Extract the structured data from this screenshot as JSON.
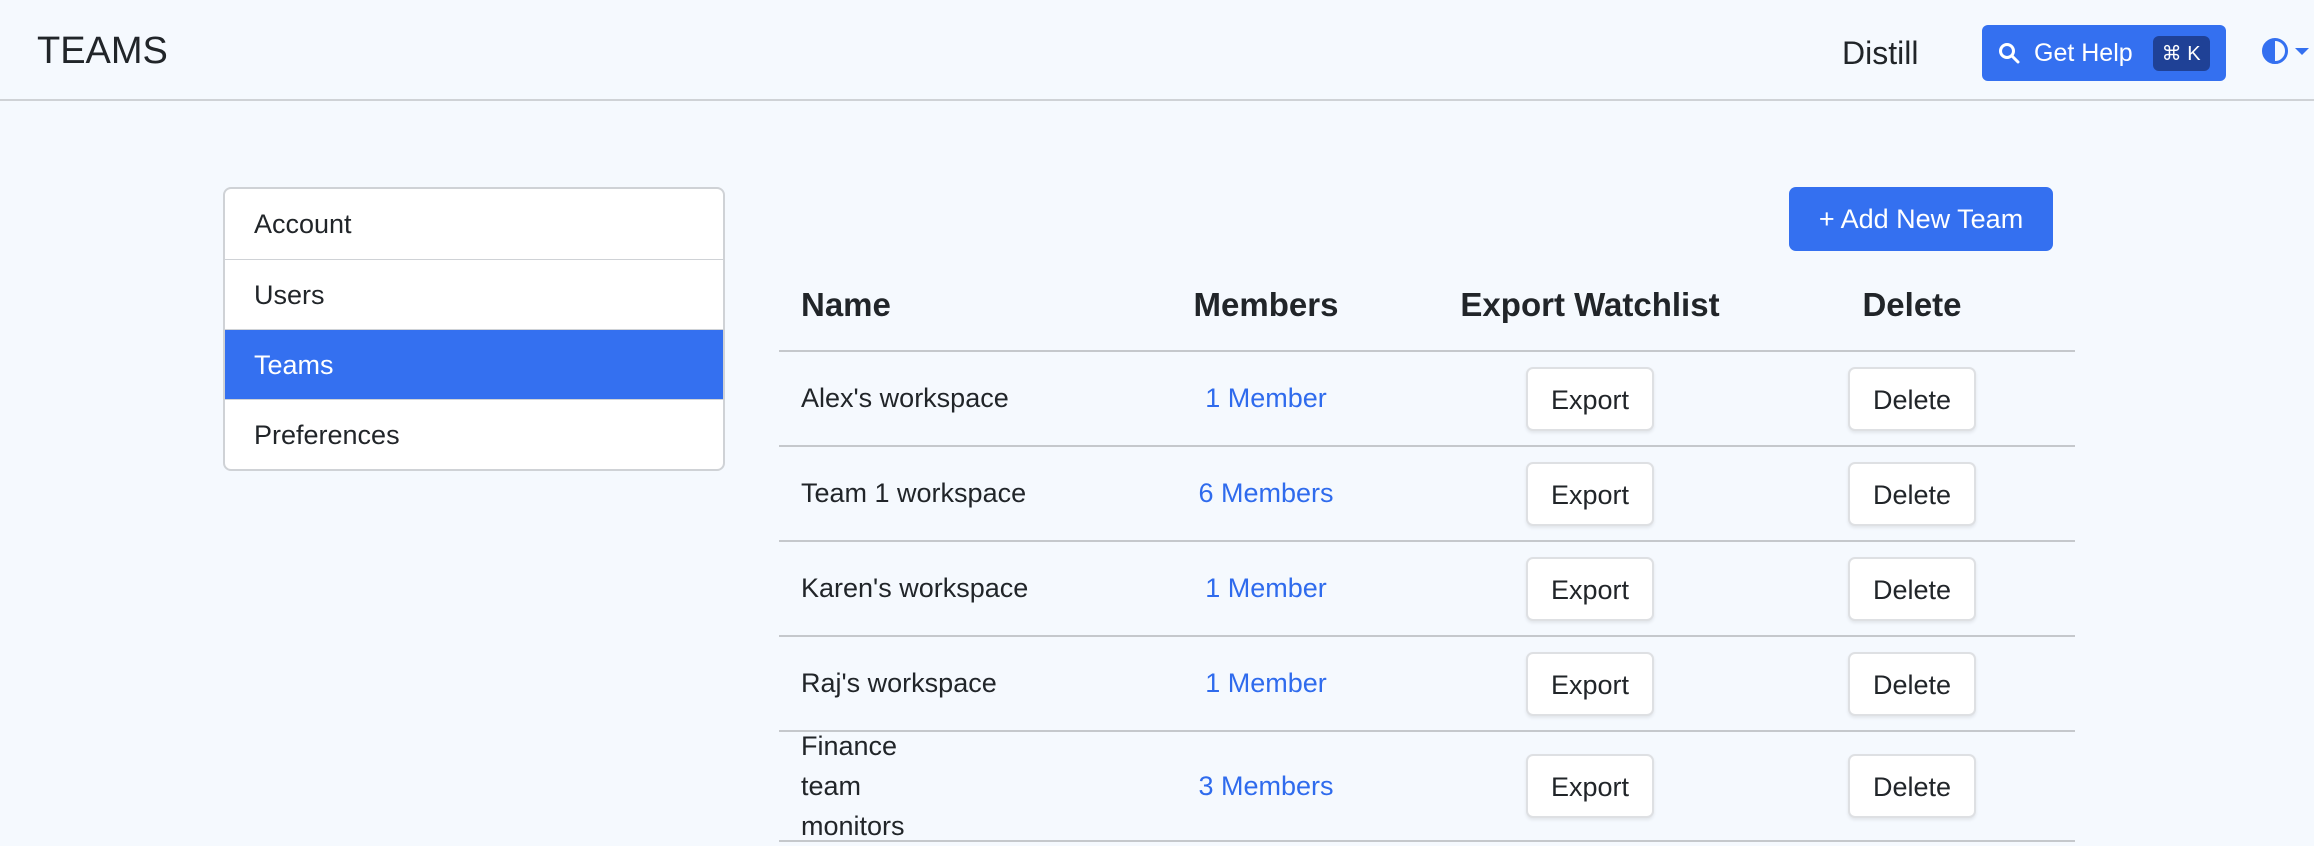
{
  "header": {
    "title": "TEAMS",
    "org": "Distill",
    "help_label": "Get Help",
    "help_shortcut": "⌘ K"
  },
  "sidebar": {
    "items": [
      {
        "label": "Account"
      },
      {
        "label": "Users"
      },
      {
        "label": "Teams",
        "active": true
      },
      {
        "label": "Preferences"
      }
    ]
  },
  "main": {
    "add_label": "+ Add New Team",
    "columns": [
      "Name",
      "Members",
      "Export Watchlist",
      "Delete"
    ],
    "rows": [
      {
        "name": "Alex's workspace",
        "members": "1 Member",
        "export": "Export",
        "delete": "Delete"
      },
      {
        "name": "Team 1 workspace",
        "members": "6 Members",
        "export": "Export",
        "delete": "Delete"
      },
      {
        "name": "Karen's workspace",
        "members": "1 Member",
        "export": "Export",
        "delete": "Delete"
      },
      {
        "name": "Raj's workspace",
        "members": "1 Member",
        "export": "Export",
        "delete": "Delete"
      },
      {
        "name": "Finance team monitors",
        "members": "3 Members",
        "export": "Export",
        "delete": "Delete"
      }
    ]
  },
  "colors": {
    "accent": "#3470f0",
    "link": "#2f6bed"
  }
}
